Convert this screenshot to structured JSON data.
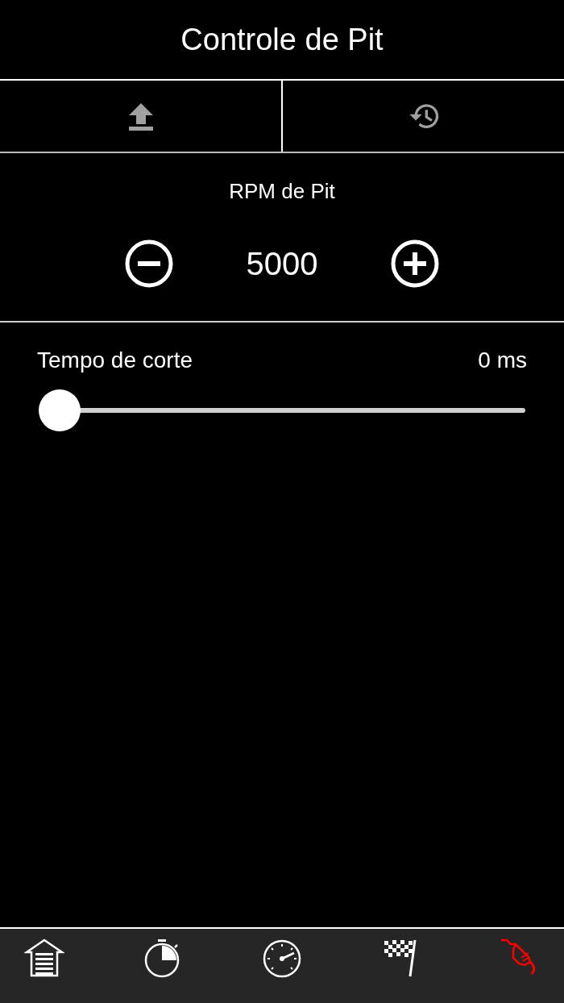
{
  "title": "Controle de Pit",
  "toolbar": [
    {
      "kind": "upload"
    },
    {
      "kind": "history"
    }
  ],
  "rpm": {
    "label": "RPM de Pit",
    "value": "5000"
  },
  "cut_time": {
    "label": "Tempo de corte",
    "reading": "0 ms",
    "level": 0
  },
  "tabs": [
    {
      "kind": "garage",
      "selected": false
    },
    {
      "kind": "stopwatch",
      "selected": false
    },
    {
      "kind": "gauge",
      "selected": false
    },
    {
      "kind": "flag",
      "selected": false
    },
    {
      "kind": "fuel",
      "selected": true
    }
  ]
}
